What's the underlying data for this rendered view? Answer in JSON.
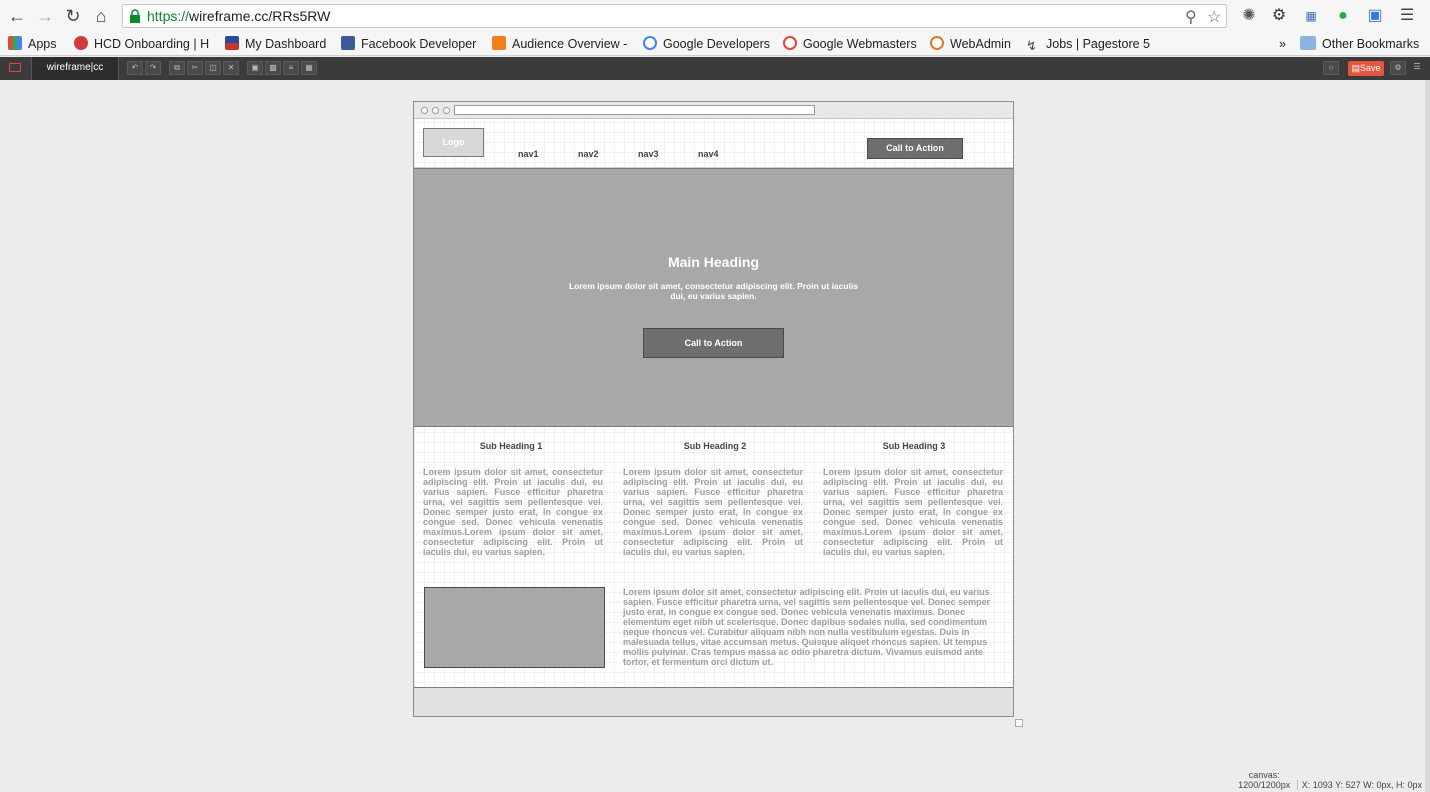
{
  "browser": {
    "url_scheme": "https://",
    "url_rest": "wireframe.cc/RRs5RW",
    "bookmarks": [
      {
        "label": "Apps",
        "color": "#e04a3a"
      },
      {
        "label": "HCD Onboarding | H",
        "color": "#d33a3a"
      },
      {
        "label": "My Dashboard",
        "color": "#2d4a9a"
      },
      {
        "label": "Facebook Developer",
        "color": "#3b5998"
      },
      {
        "label": "Audience Overview -",
        "color": "#f27f1b"
      },
      {
        "label": "Google Developers",
        "color": "#4285f4"
      },
      {
        "label": "Google Webmasters",
        "color": "#4285f4"
      },
      {
        "label": "WebAdmin",
        "color": "#e0782a"
      },
      {
        "label": "Jobs | Pagestore 5",
        "color": "#444444"
      }
    ],
    "overflow": "»",
    "other_bookmarks": "Other Bookmarks"
  },
  "app": {
    "brand": "wireframe|cc",
    "save_label": "Save"
  },
  "wireframe": {
    "logo": "Logo",
    "nav": [
      "nav1",
      "nav2",
      "nav3",
      "nav4"
    ],
    "cta_top": "Call to Action",
    "hero_heading": "Main Heading",
    "hero_lead": "Lorem ipsum dolor sit amet, consectetur adipiscing elit. Proin ut iaculis dui, eu varius sapien.",
    "hero_cta": "Call to Action",
    "sub_headings": [
      "Sub Heading 1",
      "Sub Heading 2",
      "Sub Heading 3"
    ],
    "column_text": "Lorem ipsum dolor sit amet, consectetur adipiscing elit. Proin ut iaculis dui, eu varius sapien. Fusce efficitur pharetra urna, vel sagittis sem pellentesque vel. Donec semper justo erat, in congue ex congue sed. Donec vehicula venenatis maximus.Lorem ipsum dolor sit amet, consectetur adipiscing elit. Proin ut iaculis dui, eu varius sapien.",
    "bottom_text": "Lorem ipsum dolor sit amet, consectetur adipiscing elit. Proin ut iaculis dui, eu varius sapien. Fusce efficitur pharetra urna, vel sagittis sem pellentesque vel. Donec semper justo erat, in congue ex congue sed. Donec vehicula venenatis maximus. Donec elementum eget nibh ut scelerisque. Donec dapibus sodales nulla, sed condimentum neque rhoncus vel. Curabitur aliquam nibh non nulla vestibulum egestas. Duis in malesuada tellus, vitae accumsan metus. Quisque aliquet rhoncus sapien. Ut tempus mollis pulvinar. Cras tempus massa ac odio pharetra dictum. Vivamus euismod ante tortor, et fermentum orci dictum ut."
  },
  "status": {
    "canvas_label": "canvas:",
    "canvas_size": "1200/1200px",
    "coords": "X: 1093 Y: 527 W: 0px, H: 0px"
  }
}
